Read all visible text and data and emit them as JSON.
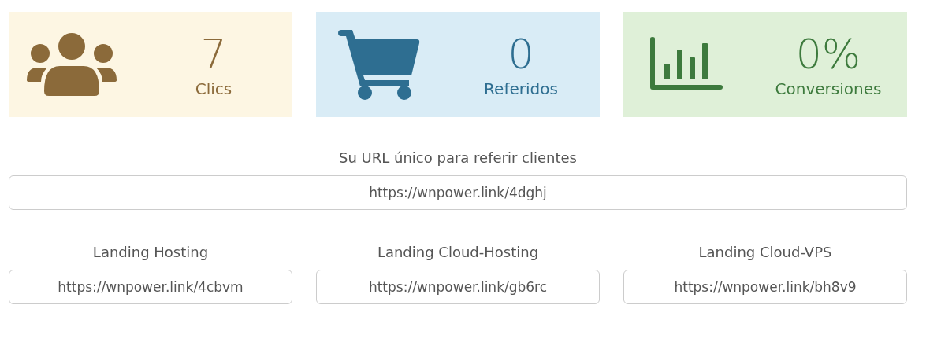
{
  "stats": [
    {
      "kind": "users",
      "value": "7",
      "label": "Clics"
    },
    {
      "kind": "cart",
      "value": "0",
      "label": "Referidos"
    },
    {
      "kind": "chart",
      "value": "0%",
      "label": "Conversiones"
    }
  ],
  "main_link": {
    "label": "Su URL único para referir clientes",
    "value": "https://wnpower.link/4dghj"
  },
  "landings": [
    {
      "label": "Landing Hosting",
      "value": "https://wnpower.link/4cbvm"
    },
    {
      "label": "Landing Cloud-Hosting",
      "value": "https://wnpower.link/gb6rc"
    },
    {
      "label": "Landing Cloud-VPS",
      "value": "https://wnpower.link/bh8v9"
    }
  ]
}
